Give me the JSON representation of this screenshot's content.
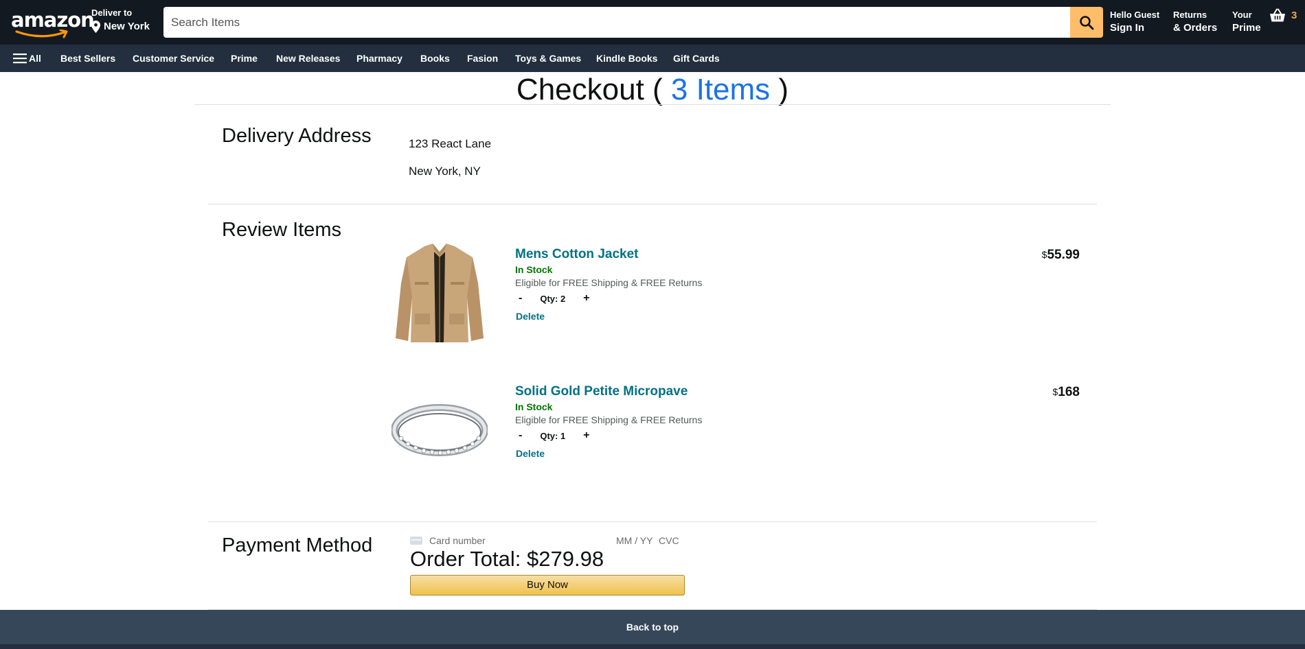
{
  "header": {
    "logo_text": "amazon",
    "deliver_small": "Deliver to",
    "deliver_city": "New York",
    "search_placeholder": "Search Items",
    "signin_line1": "Hello Guest",
    "signin_line2": "Sign In",
    "orders_line1": "Returns",
    "orders_line2": "& Orders",
    "prime_line1": "Your",
    "prime_line2": "Prime",
    "basket_count": "3"
  },
  "subnav": {
    "all_label": "All",
    "items": [
      "Best Sellers",
      "Customer Service",
      "Prime",
      "New Releases",
      "Pharmacy",
      "Books",
      "Fasion",
      "Toys & Games",
      "Kindle Books",
      "Gift Cards"
    ]
  },
  "checkout": {
    "title_prefix": "Checkout ( ",
    "title_count": "3 Items",
    "title_suffix": " )",
    "delivery_heading": "Delivery Address",
    "address_line1": "123 React Lane",
    "address_line2": "New York, NY",
    "review_heading": "Review Items",
    "items": [
      {
        "title": "Mens Cotton Jacket",
        "stock": "In Stock",
        "eligibility": "Eligible for FREE Shipping & FREE Returns",
        "qty_label": "Qty: 2",
        "minus": "-",
        "plus": "+",
        "delete": "Delete",
        "currency": "$",
        "price": "55.99",
        "image": "jacket-image"
      },
      {
        "title": "Solid Gold Petite Micropave",
        "stock": "In Stock",
        "eligibility": "Eligible for FREE Shipping & FREE Returns",
        "qty_label": "Qty: 1",
        "minus": "-",
        "plus": "+",
        "delete": "Delete",
        "currency": "$",
        "price": "168",
        "image": "ring-image"
      }
    ],
    "payment_heading": "Payment Method",
    "card_number_placeholder": "Card number",
    "card_expiry_placeholder": "MM / YY",
    "card_cvc_placeholder": "CVC",
    "order_total": "Order Total: $279.98",
    "buy_now": "Buy Now"
  },
  "footer": {
    "back_to_top": "Back to top"
  },
  "colors": {
    "header_bg": "#131921",
    "subnav_bg": "#232f3e",
    "search_button": "#febd69",
    "basket_count": "#f3a847",
    "link": "#007185",
    "in_stock": "#007600",
    "title_count": "#1a73e8",
    "footer_bg": "#37475a"
  }
}
